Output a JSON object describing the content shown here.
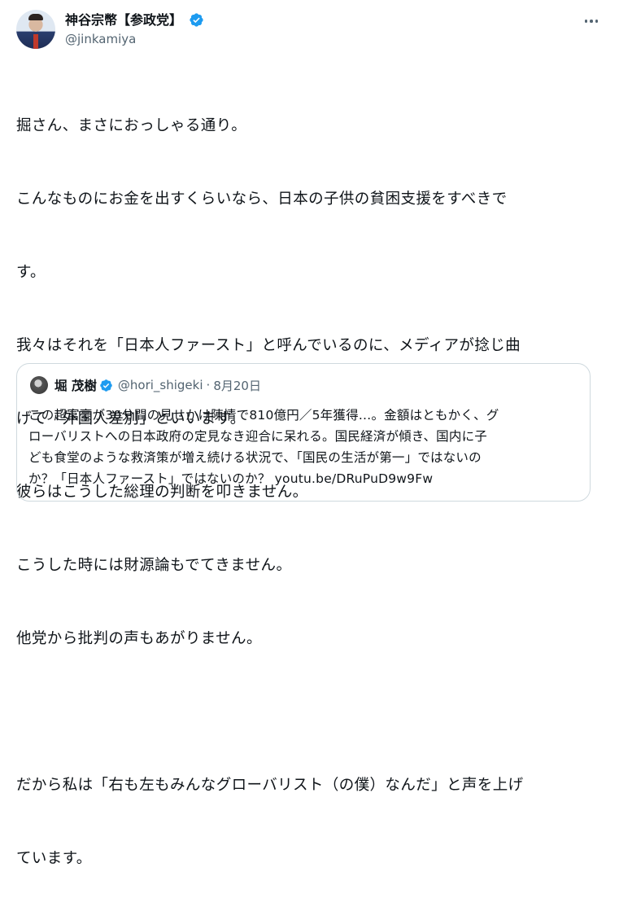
{
  "author": {
    "display_name": "神谷宗幣【参政党】",
    "handle": "@jinkamiya"
  },
  "tweet": {
    "lines": [
      "掘さん、まさにおっしゃる通り。",
      "こんなものにお金を出すくらいなら、日本の子供の貧困支援をすべきで",
      "す。",
      "我々はそれを「日本人ファースト」と呼んでいるのに、メディアが捻じ曲",
      "げて「外国人差別」といいます。",
      "彼らはこうした総理の判断を叩きません。",
      "こうした時には財源論もでてきません。",
      "他党から批判の声もあがりません。",
      "",
      "だから私は「右も左もみんなグローバリスト（の僕）なんだ」と声を上げ",
      "ています。"
    ]
  },
  "quote": {
    "display_name": "堀 茂樹",
    "handle": "@hori_shigeki",
    "separator": "·",
    "date": "8月20日",
    "lines": [
      "この超富豪が30分間の見せかけ陳情で810億円／5年獲得…。金額はともかく、グ",
      "ローバリストへの日本政府の定見なき迎合に呆れる。国民経済が傾き、国内に子",
      "ども食堂のような救済策が増え続ける状況で、「国民の生活が第一」ではないの",
      "か？「日本人ファースト」ではないのか？ youtu.be/DRuPuD9w9Fw"
    ]
  },
  "icons": {
    "verified": "verified-badge-icon",
    "more": "more-options-icon"
  },
  "colors": {
    "verified": "#1d9bf0",
    "text": "#0f1419",
    "secondary": "#536471",
    "border": "#cfd9de"
  }
}
